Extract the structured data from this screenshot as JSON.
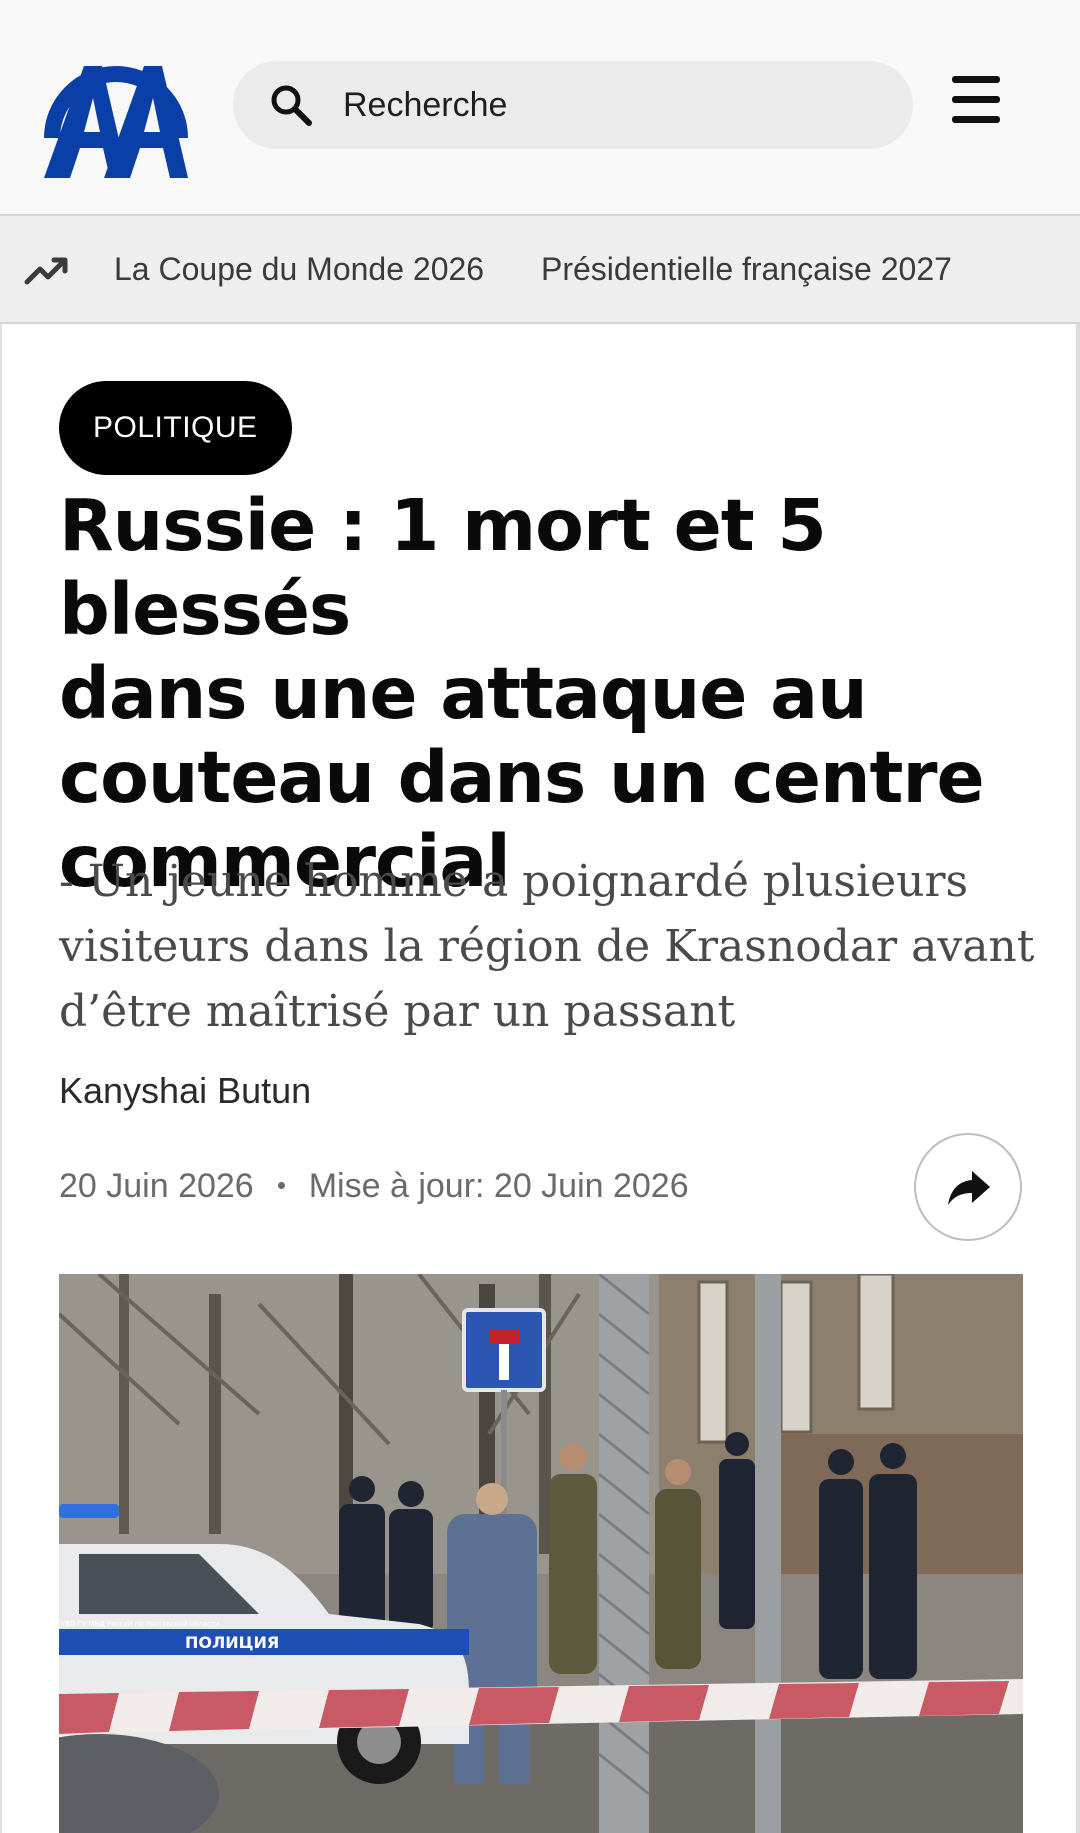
{
  "header": {
    "logo_alt": "AA",
    "search_placeholder": "Recherche"
  },
  "trending": {
    "icon": "trending-up-icon",
    "links": [
      "La Coupe du Monde 2026",
      "Présidentielle française 2027"
    ]
  },
  "article": {
    "category": "POLITIQUE",
    "headline_lines": [
      "Russie : 1 mort et 5 blessés",
      "dans une attaque au",
      "couteau dans un centre",
      "commercial"
    ],
    "subtitle_lines": [
      "- Un jeune homme a poignardé plusieurs",
      "visiteurs dans la région de Krasnodar avant",
      "d’être maîtrisé par un passant"
    ],
    "author": "Kanyshai Butun",
    "published": "20 Juin 2026",
    "updated": "Mise à jour: 20 Juin 2026",
    "share_icon": "share-arrow-icon",
    "photo": {
      "police_car_text": "ПОЛИЦИЯ",
      "car_door_text": "УВО ГУ МВД России по Ростовской области"
    }
  },
  "colors": {
    "brand_blue": "#0b3fa8",
    "category_bg": "#000000",
    "header_bg": "#f8f8f8",
    "trend_bg": "#eeeeee"
  }
}
